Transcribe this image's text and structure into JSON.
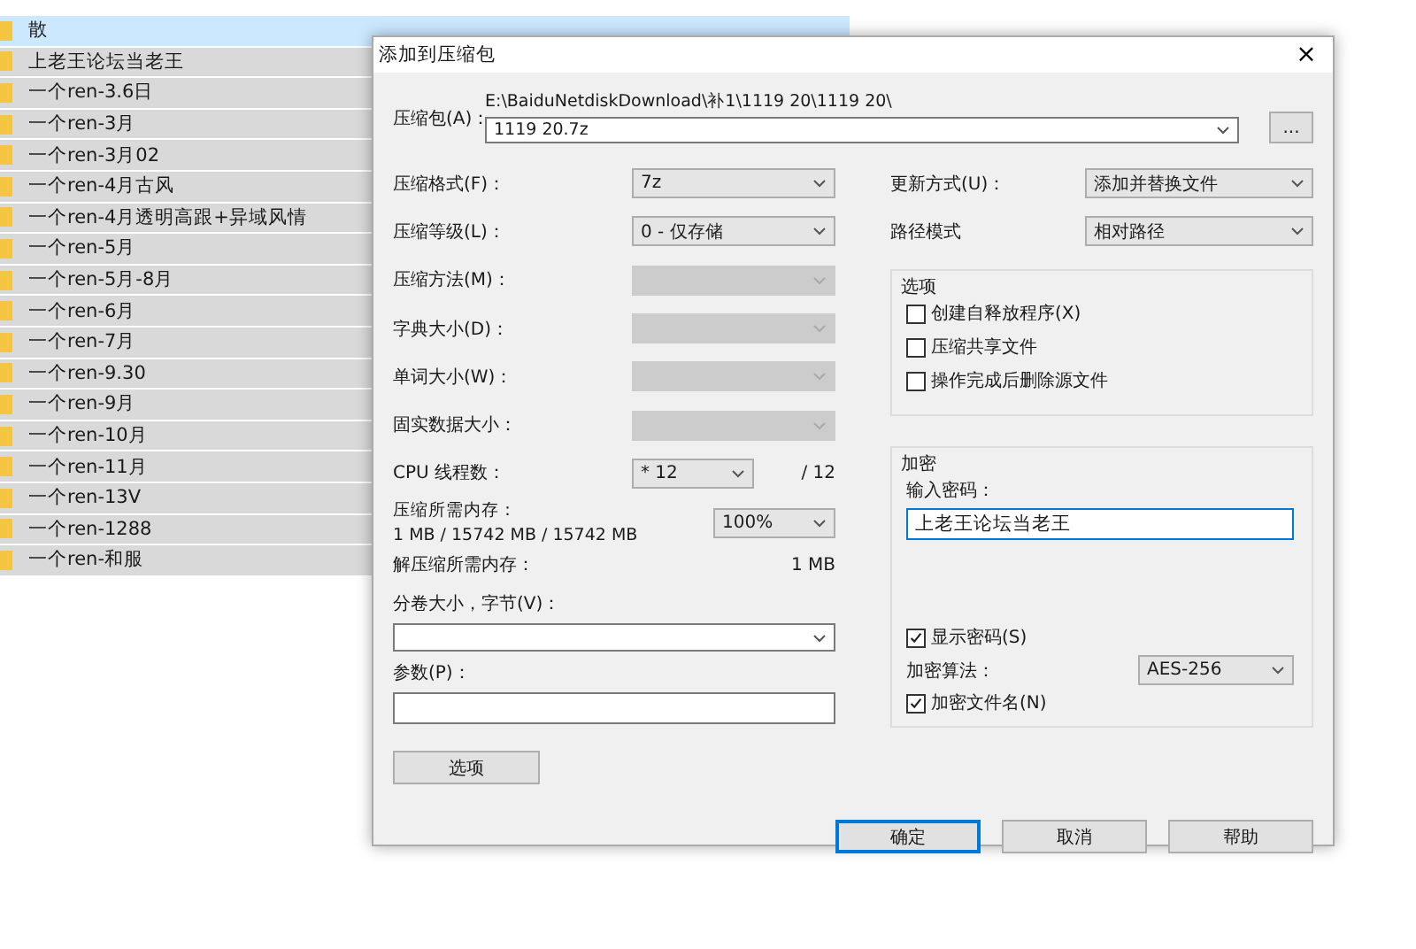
{
  "file_list": {
    "rows": [
      {
        "name": "散",
        "selected": true,
        "focused": true
      },
      {
        "name": "上老王论坛当老王",
        "selected": true,
        "focused": false
      },
      {
        "name": "一个ren-3.6日",
        "selected": true,
        "focused": false
      },
      {
        "name": "一个ren-3月",
        "selected": true,
        "focused": false
      },
      {
        "name": "一个ren-3月02",
        "selected": true,
        "focused": false
      },
      {
        "name": "一个ren-4月古风",
        "selected": true,
        "focused": false
      },
      {
        "name": "一个ren-4月透明高跟+异域风情",
        "selected": true,
        "focused": false
      },
      {
        "name": "一个ren-5月",
        "selected": true,
        "focused": false
      },
      {
        "name": "一个ren-5月-8月",
        "selected": true,
        "focused": false
      },
      {
        "name": "一个ren-6月",
        "selected": true,
        "focused": false
      },
      {
        "name": "一个ren-7月",
        "selected": true,
        "focused": false
      },
      {
        "name": "一个ren-9.30",
        "selected": true,
        "focused": false
      },
      {
        "name": "一个ren-9月",
        "selected": true,
        "focused": false
      },
      {
        "name": "一个ren-10月",
        "selected": true,
        "focused": false
      },
      {
        "name": "一个ren-11月",
        "selected": true,
        "focused": false
      },
      {
        "name": "一个ren-13V",
        "selected": true,
        "focused": false
      },
      {
        "name": "一个ren-1288",
        "selected": true,
        "focused": false
      },
      {
        "name": "一个ren-和服",
        "selected": true,
        "focused": false
      }
    ]
  },
  "dialog": {
    "title": "添加到压缩包",
    "close": "×",
    "archive": {
      "label": "压缩包(A)：",
      "path": "E:\\BaiduNetdiskDownload\\补1\\1119 20\\1119 20\\",
      "value": "1119 20.7z",
      "browse": "..."
    },
    "settings": [
      {
        "kind": "select",
        "label": "压缩格式(F)：",
        "value": "7z",
        "disabled": false
      },
      {
        "kind": "select",
        "label": "压缩等级(L)：",
        "value": "0 - 仅存储",
        "disabled": false
      },
      {
        "kind": "select",
        "label": "压缩方法(M)：",
        "disabled": true
      },
      {
        "kind": "select",
        "label": "字典大小(D)：",
        "disabled": true
      },
      {
        "kind": "select",
        "label": "单词大小(W)：",
        "disabled": true
      },
      {
        "kind": "select",
        "label": "固实数据大小：",
        "disabled": true
      },
      {
        "kind": "cpu",
        "label": "CPU 线程数：",
        "value": "* 12",
        "suffix": "/ 12"
      },
      {
        "kind": "memory",
        "label": "压缩所需内存：",
        "detail": "1 MB / 15742 MB / 15742 MB",
        "value": "100%"
      },
      {
        "kind": "info",
        "label": "解压缩所需内存：",
        "value": "1 MB"
      }
    ],
    "split": {
      "label": "分卷大小，字节(V)："
    },
    "params": {
      "label": "参数(P)："
    },
    "options_button": "选项",
    "update": {
      "label": "更新方式(U)：",
      "value": "添加并替换文件"
    },
    "path_mode": {
      "label": "路径模式",
      "value": "相对路径"
    },
    "options_group": {
      "title": "选项",
      "items": [
        {
          "label": "创建自释放程序(X)",
          "checked": false
        },
        {
          "label": "压缩共享文件",
          "checked": false
        },
        {
          "label": "操作完成后删除源文件",
          "checked": false
        }
      ]
    },
    "encryption": {
      "title": "加密",
      "password_label": "输入密码：",
      "password": "上老王论坛当老王",
      "show_password": {
        "label": "显示密码(S)",
        "checked": true
      },
      "method_label": "加密算法：",
      "method": "AES-256",
      "encrypt_names": {
        "label": "加密文件名(N)",
        "checked": true
      }
    },
    "buttons": [
      {
        "label": "确定",
        "default": true
      },
      {
        "label": "取消",
        "default": false
      },
      {
        "label": "帮助",
        "default": false
      }
    ]
  }
}
